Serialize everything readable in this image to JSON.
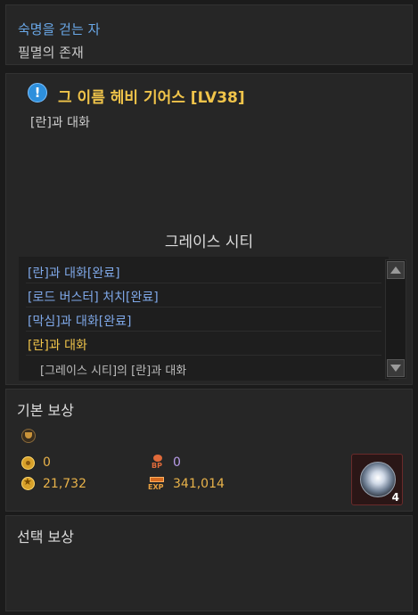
{
  "header": {
    "title": "숙명을 걷는 자",
    "subtitle": "필멸의 존재"
  },
  "quest": {
    "title": "그 이름 헤비 기어스 [LV38]",
    "description": "[란]과 대화",
    "location": "그레이스 시티",
    "objectives": [
      {
        "label": "[란]과 대화[완료]",
        "state": "done"
      },
      {
        "label": "[로드 버스터] 처치[완료]",
        "state": "done"
      },
      {
        "label": "[막심]과 대화[완료]",
        "state": "done"
      },
      {
        "label": "[란]과 대화",
        "state": "active"
      },
      {
        "label": "[그레이스 시티]의 [란]과 대화",
        "state": "sub"
      }
    ]
  },
  "basic_reward": {
    "title": "기본 보상",
    "nut": "0",
    "bp": "0",
    "gold": "21,732",
    "exp": "341,014",
    "item_count": "4"
  },
  "choice_reward": {
    "title": "선택 보상"
  },
  "icons": {
    "quest": "exclamation-icon",
    "trophy": "trophy-icon",
    "nut": "nut-coin-icon",
    "bp": "bp-icon",
    "gold": "gold-coin-icon",
    "exp": "exp-icon",
    "item": "gem-item-icon"
  },
  "colors": {
    "header_title": "#6aa8e8",
    "quest_title": "#f0c44a",
    "objective_done": "#7fa8e8",
    "objective_active": "#f0c44a",
    "reward_value": "#e8b24a",
    "bp_value": "#b89ce8"
  }
}
